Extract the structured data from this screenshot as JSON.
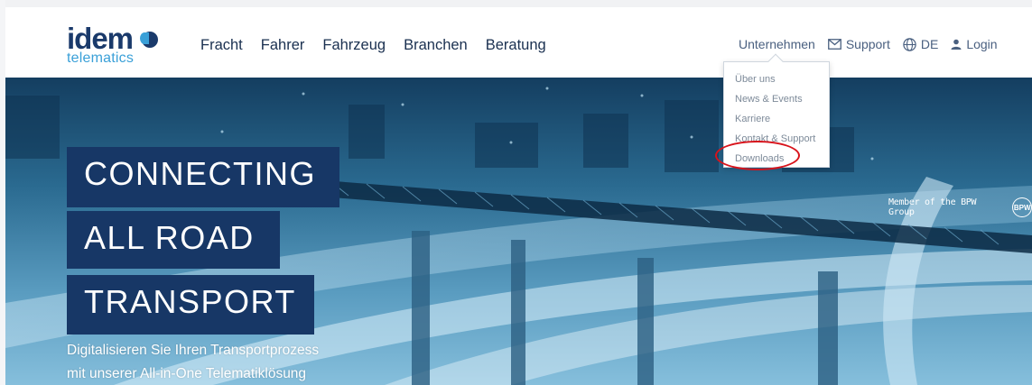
{
  "brand": {
    "name": "idem",
    "sub": "telematics"
  },
  "main_nav": [
    "Fracht",
    "Fahrer",
    "Fahrzeug",
    "Branchen",
    "Beratung"
  ],
  "util_nav": {
    "unternehmen": "Unternehmen",
    "support": "Support",
    "language": "DE",
    "login": "Login"
  },
  "dropdown": [
    "Über uns",
    "News & Events",
    "Karriere",
    "Kontakt & Support",
    "Downloads"
  ],
  "bpw": {
    "text": "Member of the BPW Group",
    "logo": "BPW"
  },
  "hero": {
    "headline": [
      "CONNECTING",
      "ALL ROAD",
      "TRANSPORT"
    ],
    "subline": [
      "Digitalisieren Sie Ihren Transportprozess",
      "mit unserer All-in-One Telematiklösung"
    ]
  },
  "colors": {
    "brand_dark": "#173766",
    "brand_light": "#3aa0d8",
    "highlight": "#d8131b"
  },
  "icons": {
    "support": "envelope-icon",
    "language": "globe-icon",
    "login": "user-icon"
  }
}
